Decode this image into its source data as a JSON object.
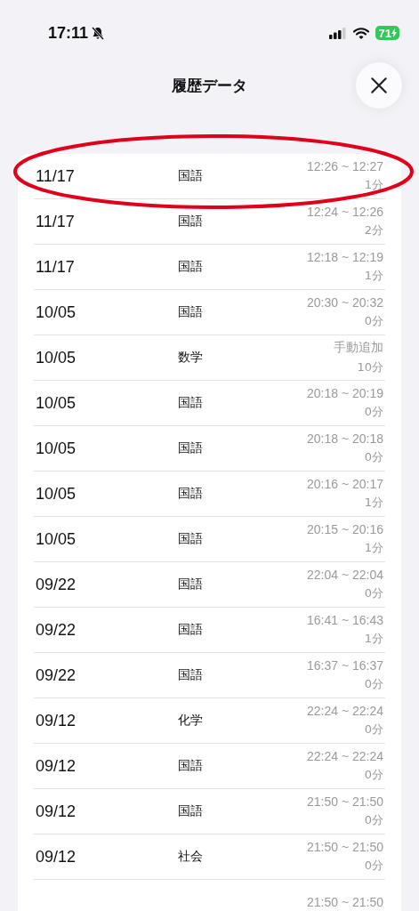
{
  "status_bar": {
    "time": "17:11",
    "silent": true,
    "battery": "71"
  },
  "header": {
    "title": "履歴データ"
  },
  "rows": [
    {
      "date": "11/17",
      "subject": "国語",
      "time_range": "12:26 ~ 12:27",
      "duration": "1分"
    },
    {
      "date": "11/17",
      "subject": "国語",
      "time_range": "12:24 ~ 12:26",
      "duration": "2分"
    },
    {
      "date": "11/17",
      "subject": "国語",
      "time_range": "12:18 ~ 12:19",
      "duration": "1分"
    },
    {
      "date": "10/05",
      "subject": "国語",
      "time_range": "20:30 ~ 20:32",
      "duration": "0分"
    },
    {
      "date": "10/05",
      "subject": "数学",
      "time_range": "手動追加",
      "duration": "10分"
    },
    {
      "date": "10/05",
      "subject": "国語",
      "time_range": "20:18 ~ 20:19",
      "duration": "0分"
    },
    {
      "date": "10/05",
      "subject": "国語",
      "time_range": "20:18 ~ 20:18",
      "duration": "0分"
    },
    {
      "date": "10/05",
      "subject": "国語",
      "time_range": "20:16 ~ 20:17",
      "duration": "1分"
    },
    {
      "date": "10/05",
      "subject": "国語",
      "time_range": "20:15 ~ 20:16",
      "duration": "1分"
    },
    {
      "date": "09/22",
      "subject": "国語",
      "time_range": "22:04 ~ 22:04",
      "duration": "0分"
    },
    {
      "date": "09/22",
      "subject": "国語",
      "time_range": "16:41 ~ 16:43",
      "duration": "1分"
    },
    {
      "date": "09/22",
      "subject": "国語",
      "time_range": "16:37 ~ 16:37",
      "duration": "0分"
    },
    {
      "date": "09/12",
      "subject": "化学",
      "time_range": "22:24 ~ 22:24",
      "duration": "0分"
    },
    {
      "date": "09/12",
      "subject": "国語",
      "time_range": "22:24 ~ 22:24",
      "duration": "0分"
    },
    {
      "date": "09/12",
      "subject": "国語",
      "time_range": "21:50 ~ 21:50",
      "duration": "0分"
    },
    {
      "date": "09/12",
      "subject": "社会",
      "time_range": "21:50 ~ 21:50",
      "duration": "0分"
    },
    {
      "time_range": "21:50 ~ 21:50"
    }
  ]
}
